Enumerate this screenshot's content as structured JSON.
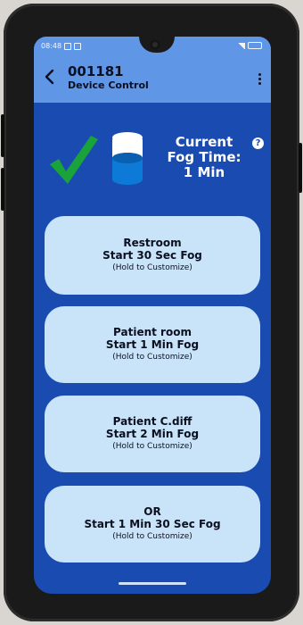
{
  "status_bar": {
    "time": "08:48"
  },
  "header": {
    "title": "001181",
    "subtitle": "Device Control"
  },
  "fog_status": {
    "label_lines": [
      "Current",
      "Fog Time:",
      "1 Min"
    ],
    "help_symbol": "?",
    "status_icon": "check-icon",
    "device_icon": "fog-canister-icon"
  },
  "presets": [
    {
      "line1": "Restroom",
      "line2": "Start 30 Sec Fog",
      "hint": "(Hold to Customize)"
    },
    {
      "line1": "Patient room",
      "line2": "Start 1 Min Fog",
      "hint": "(Hold to Customize)"
    },
    {
      "line1": "Patient C.diff",
      "line2": "Start 2 Min Fog",
      "hint": "(Hold to Customize)"
    },
    {
      "line1": "OR",
      "line2": "Start 1 Min 30 Sec Fog",
      "hint": "(Hold to Customize)"
    }
  ],
  "colors": {
    "header": "#5f96e6",
    "background": "#1a4bb0",
    "button": "#c9e3f8",
    "check": "#1aa33a"
  }
}
